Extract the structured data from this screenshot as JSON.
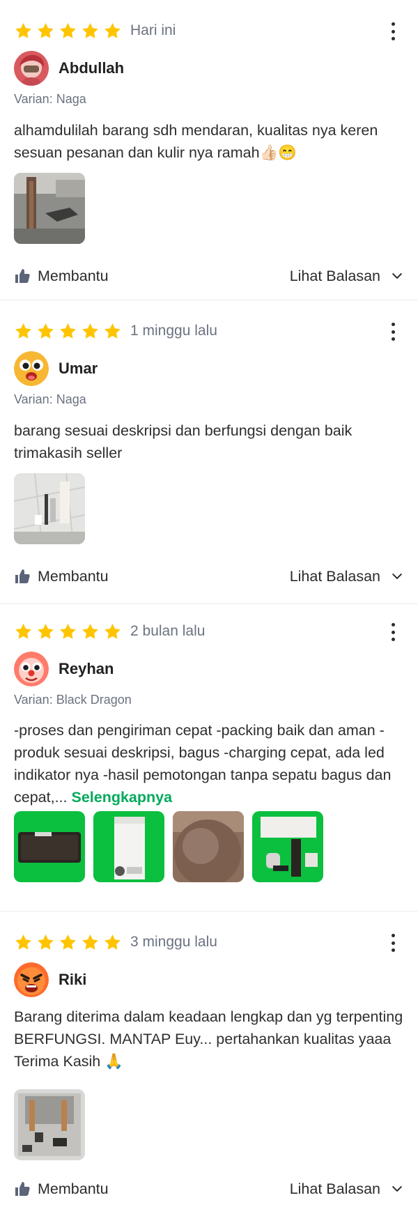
{
  "ui": {
    "helpful_label": "Membantu",
    "view_replies_label": "Lihat Balasan",
    "read_more_label": "Selengkapnya",
    "star_color": "#FFC400",
    "accent_color": "#00AA5B"
  },
  "reviews": [
    {
      "rating": 5,
      "time": "Hari ini",
      "user": "Abdullah",
      "avatar_icon": "photo-avatar",
      "variant": "Varian: Naga",
      "text": "alhamdulilah barang sdh mendaran, kualitas nya keren sesuan pesanan dan kulir nya ramah👍🏻😁",
      "photo_count": 1
    },
    {
      "rating": 5,
      "time": "1 minggu lalu",
      "user": "Umar",
      "avatar_icon": "surprised-emoji-avatar",
      "variant": "Varian: Naga",
      "text": "barang sesuai deskripsi dan berfungsi dengan baik trimakasih seller",
      "photo_count": 1
    },
    {
      "rating": 5,
      "time": "2 bulan lalu",
      "user": "Reyhan",
      "avatar_icon": "clown-emoji-avatar",
      "variant": "Varian: Black Dragon",
      "text": "-proses dan pengiriman cepat -packing baik dan aman -produk sesuai deskripsi, bagus -charging cepat, ada led indikator nya -hasil pemotongan tanpa sepatu bagus dan cepat,...",
      "photo_count": 4
    },
    {
      "rating": 5,
      "time": "3 minggu lalu",
      "user": "Riki",
      "avatar_icon": "angry-emoji-avatar",
      "text": "Barang diterima dalam keadaan lengkap dan yg terpenting BERFUNGSI. MANTAP Euy... pertahankan kualitas yaaa Terima Kasih 🙏",
      "photo_count": 1
    }
  ]
}
